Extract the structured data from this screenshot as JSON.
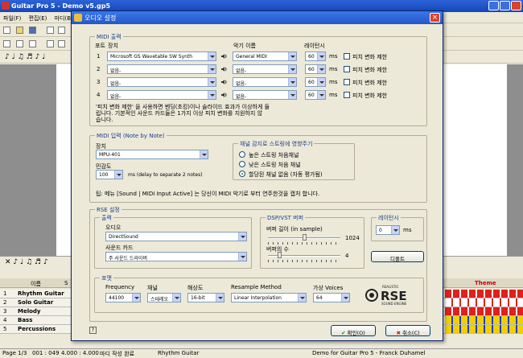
{
  "app": {
    "title": "Guitar Pro 5 - Demo v5.gp5",
    "menu": [
      "파일(F)",
      "편집(E)",
      "마디(B)"
    ],
    "score_text": "In"
  },
  "tracks": {
    "header": [
      "이름",
      "S",
      "M"
    ],
    "theme_label": "Theme",
    "rows": [
      {
        "num": "1",
        "name": "Rhythm Guitar"
      },
      {
        "num": "2",
        "name": "Solo Guitar"
      },
      {
        "num": "3",
        "name": "Melody"
      },
      {
        "num": "4",
        "name": "Bass"
      },
      {
        "num": "5",
        "name": "Percussions"
      }
    ]
  },
  "status": {
    "page": "Page 1/3",
    "bar": "001 : 049",
    "time": "4.000 : 4.000",
    "state": "마디 작성 완료",
    "track": "Rhythm Guitar",
    "song": "Demo for Guitar Pro 5 - Franck Duhamel"
  },
  "dialog": {
    "title": "오디오 설정",
    "close": "×",
    "midi_out": {
      "legend": "MIDI 출력",
      "col_port": "포트",
      "col_device": "장치",
      "col_instrument": "악기 이름",
      "col_latency": "레이턴시",
      "ports": [
        {
          "num": "1",
          "device": "Microsoft GS Wavetable SW Synth",
          "instrument": "General MIDI",
          "latency": "60",
          "unit": "ms",
          "pitch": "피치 변화 제한"
        },
        {
          "num": "2",
          "device": "없음-",
          "instrument": "없음-",
          "latency": "60",
          "unit": "ms",
          "pitch": "피치 변화 제한"
        },
        {
          "num": "3",
          "device": "없음-",
          "instrument": "없음-",
          "latency": "60",
          "unit": "ms",
          "pitch": "피치 변화 제한"
        },
        {
          "num": "4",
          "device": "없음-",
          "instrument": "없음-",
          "latency": "60",
          "unit": "ms",
          "pitch": "피치 변화 제한"
        }
      ],
      "note1": "'피치 변화 제한' 을 사용하면 벤딩(초킹)이나 슬라이드 효과가 이상하게 들",
      "note2": "립니다. 기본적인 사운드 카드들은 1가지 이상 피치 변화를 지원하지 않",
      "note3": "습니다."
    },
    "midi_in": {
      "legend": "MIDI 입력 (Note by Note)",
      "device_label": "장치",
      "device_value": "MPU-401",
      "sens_label": "민감도",
      "sens_value": "100",
      "sens_hint": "ms  (delay to separate 2 notes)",
      "channel_legend": "채널 감지로 스트링에 영향주기",
      "options": [
        "높은 스트링 처음채널",
        "낮은 스트링 처음 채널",
        "할당된 채널 없음 (자동 평가됨)"
      ],
      "tip": "팁: 메뉴 [Sound | MIDI Input Active] 는 당신이 MIDI 악기로 부터 연주한것을 캡처 합니다."
    },
    "rse": {
      "legend": "RSE 설정",
      "output_legend": "출력",
      "audio_label": "오디오",
      "audio_value": "DirectSound",
      "soundcard_label": "사운드 카드",
      "soundcard_value": "주 사운드 드라이버",
      "dsp_legend": "DSP/VST 버퍼",
      "buffer_length_label": "버퍼 길이 (in sample)",
      "buffer_length_value": "1024",
      "buffer_count_label": "버퍼의 수",
      "buffer_count_value": "4",
      "latency_legend": "레이턴시",
      "latency_value": "0",
      "latency_unit": "ms",
      "default_button": "디폴트",
      "format_legend": "포맷",
      "frequency_label": "Frequency",
      "frequency_value": "44100",
      "channel_label": "채널",
      "channel_value": "스테레오",
      "resolution_label": "해상도",
      "resolution_value": "16-bit",
      "resample_label": "Resample Method",
      "resample_value": "Linear Interpolation",
      "voices_label": "가상 Voices",
      "voices_value": "64",
      "logo_top": "REALISTIC",
      "logo_main": "RSE",
      "logo_bottom": "SOUND ENGINE"
    },
    "help": "?",
    "ok": "확인(O)",
    "cancel": "취소(C)"
  }
}
